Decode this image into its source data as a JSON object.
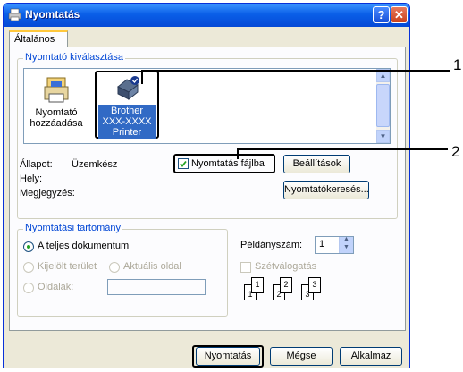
{
  "window": {
    "title": "Nyomtatás",
    "help_label": "?",
    "close_label": "✕"
  },
  "tabs": {
    "general": "Általános"
  },
  "printer_select": {
    "legend": "Nyomtató kiválasztása",
    "items": [
      {
        "label_line1": "Nyomtató",
        "label_line2": "hozzáadása"
      },
      {
        "label_line1": "Brother",
        "label_line2": "XXX-XXXX",
        "label_line3": "Printer",
        "selected": true
      }
    ],
    "status_label": "Állapot:",
    "status_value": "Üzemkész",
    "location_label": "Hely:",
    "comment_label": "Megjegyzés:",
    "print_to_file_label": "Nyomtatás fájlba",
    "print_to_file_checked": true,
    "preferences_button": "Beállítások",
    "find_printer_button": "Nyomtatókeresés..."
  },
  "page_range": {
    "legend": "Nyomtatási tartomány",
    "all_label": "A teljes dokumentum",
    "selection_label": "Kijelölt terület",
    "current_page_label": "Aktuális oldal",
    "pages_label": "Oldalak:",
    "pages_value": ""
  },
  "copies": {
    "label": "Példányszám:",
    "value": "1",
    "collate_label": "Szétválogatás",
    "collate_icon_labels": [
      "1",
      "1",
      "2",
      "2",
      "3",
      "3"
    ]
  },
  "footer": {
    "print_button": "Nyomtatás",
    "cancel_button": "Mégse",
    "apply_button": "Alkalmaz"
  },
  "callouts": {
    "first": "1",
    "second": "2"
  },
  "colors": {
    "title_bar": "#0a5fe8",
    "legend_text": "#0046d5",
    "selection": "#316ac5",
    "dialog_bg": "#ece9d8"
  }
}
